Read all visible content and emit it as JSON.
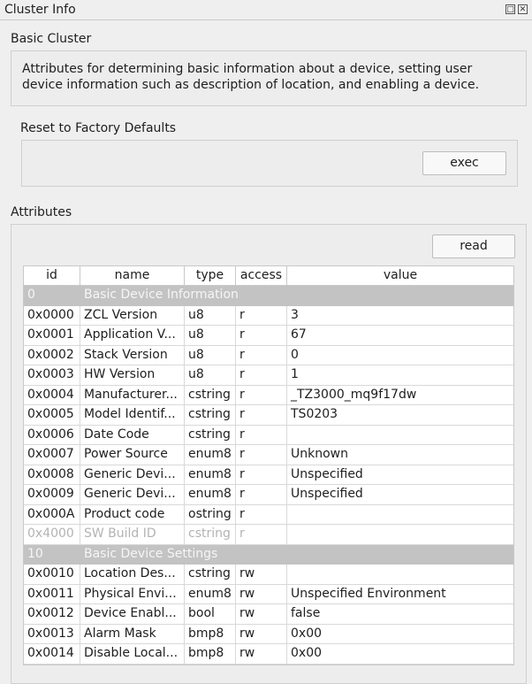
{
  "window": {
    "title": "Cluster Info",
    "float_icon": "restore-icon",
    "close_icon": "close-icon"
  },
  "basic_cluster": {
    "label": "Basic Cluster",
    "description": "Attributes for determining basic information about a device, setting user device information such as description of location, and enabling a device."
  },
  "reset": {
    "label": "Reset to Factory Defaults",
    "exec_label": "exec"
  },
  "attributes": {
    "label": "Attributes",
    "read_label": "read",
    "columns": [
      "id",
      "name",
      "type",
      "access",
      "value"
    ],
    "rows": [
      {
        "kind": "group",
        "id": "0",
        "name": "Basic Device Information"
      },
      {
        "kind": "attr",
        "id": "0x0000",
        "name": "ZCL Version",
        "type": "u8",
        "access": "r",
        "value": "3"
      },
      {
        "kind": "attr",
        "id": "0x0001",
        "name": "Application V...",
        "type": "u8",
        "access": "r",
        "value": "67"
      },
      {
        "kind": "attr",
        "id": "0x0002",
        "name": "Stack Version",
        "type": "u8",
        "access": "r",
        "value": "0"
      },
      {
        "kind": "attr",
        "id": "0x0003",
        "name": "HW Version",
        "type": "u8",
        "access": "r",
        "value": "1"
      },
      {
        "kind": "attr",
        "id": "0x0004",
        "name": "Manufacturer...",
        "type": "cstring",
        "access": "r",
        "value": "_TZ3000_mq9f17dw"
      },
      {
        "kind": "attr",
        "id": "0x0005",
        "name": "Model Identif...",
        "type": "cstring",
        "access": "r",
        "value": "TS0203"
      },
      {
        "kind": "attr",
        "id": "0x0006",
        "name": "Date Code",
        "type": "cstring",
        "access": "r",
        "value": ""
      },
      {
        "kind": "attr",
        "id": "0x0007",
        "name": "Power Source",
        "type": "enum8",
        "access": "r",
        "value": "Unknown"
      },
      {
        "kind": "attr",
        "id": "0x0008",
        "name": "Generic Devi...",
        "type": "enum8",
        "access": "r",
        "value": "Unspecified"
      },
      {
        "kind": "attr",
        "id": "0x0009",
        "name": "Generic Devi...",
        "type": "enum8",
        "access": "r",
        "value": "Unspecified"
      },
      {
        "kind": "attr",
        "id": "0x000A",
        "name": "Product code",
        "type": "ostring",
        "access": "r",
        "value": ""
      },
      {
        "kind": "disabled",
        "id": "0x4000",
        "name": "SW Build ID",
        "type": "cstring",
        "access": "r",
        "value": ""
      },
      {
        "kind": "group",
        "id": "10",
        "name": "Basic Device Settings"
      },
      {
        "kind": "attr",
        "id": "0x0010",
        "name": "Location Des...",
        "type": "cstring",
        "access": "rw",
        "value": ""
      },
      {
        "kind": "attr",
        "id": "0x0011",
        "name": "Physical Envi...",
        "type": "enum8",
        "access": "rw",
        "value": "Unspecified Environment"
      },
      {
        "kind": "attr",
        "id": "0x0012",
        "name": "Device Enabl...",
        "type": "bool",
        "access": "rw",
        "value": "false"
      },
      {
        "kind": "attr",
        "id": "0x0013",
        "name": "Alarm Mask",
        "type": "bmp8",
        "access": "rw",
        "value": "0x00"
      },
      {
        "kind": "attr",
        "id": "0x0014",
        "name": "Disable Local...",
        "type": "bmp8",
        "access": "rw",
        "value": "0x00"
      }
    ]
  }
}
